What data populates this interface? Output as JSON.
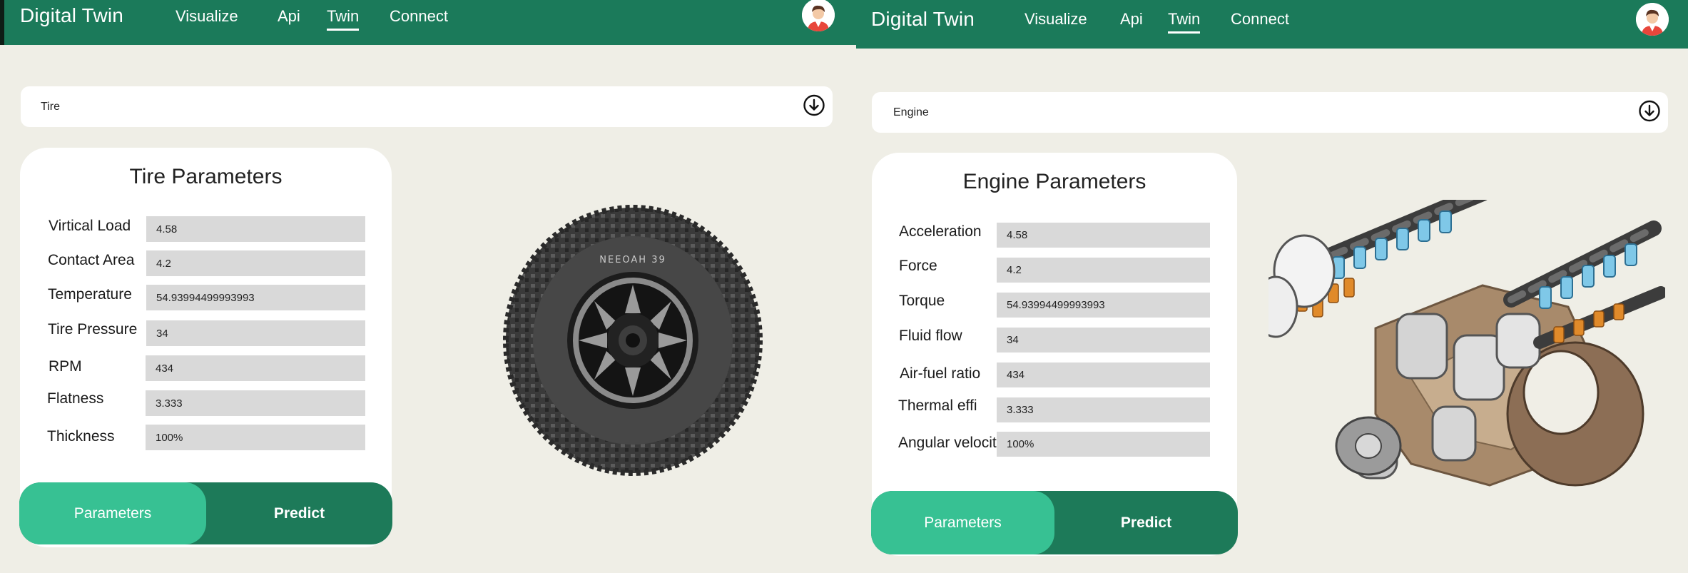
{
  "left": {
    "header": {
      "brand": "Digital Twin",
      "nav": [
        "Visualize",
        "Api",
        "Twin",
        "Connect"
      ],
      "active_nav": "Twin"
    },
    "selector": {
      "value": "Tire"
    },
    "card": {
      "title": "Tire Parameters",
      "params": [
        {
          "label": "Virtical Load",
          "value": "4.58"
        },
        {
          "label": "Contact Area",
          "value": "4.2"
        },
        {
          "label": "Temperature",
          "value": "54.93994499993993"
        },
        {
          "label": "Tire Pressure",
          "value": "34"
        },
        {
          "label": "RPM",
          "value": "434"
        },
        {
          "label": "Flatness",
          "value": "3.333"
        },
        {
          "label": "Thickness",
          "value": "100%"
        }
      ]
    },
    "toggle": {
      "parameters": "Parameters",
      "predict": "Predict"
    },
    "visual": {
      "tire_sidewall_text": "NEEOAH 39"
    }
  },
  "right": {
    "header": {
      "brand": "Digital Twin",
      "nav": [
        "Visualize",
        "Api",
        "Twin",
        "Connect"
      ],
      "active_nav": "Twin"
    },
    "selector": {
      "value": "Engine"
    },
    "card": {
      "title": "Engine Parameters",
      "params": [
        {
          "label": "Acceleration",
          "value": "4.58"
        },
        {
          "label": "Force",
          "value": "4.2"
        },
        {
          "label": "Torque",
          "value": "54.93994499993993"
        },
        {
          "label": "Fluid flow",
          "value": "34"
        },
        {
          "label": "Air-fuel ratio",
          "value": "434"
        },
        {
          "label": "Thermal effi",
          "value": "3.333"
        },
        {
          "label": "Angular velocity",
          "value": "100%"
        }
      ]
    },
    "toggle": {
      "parameters": "Parameters",
      "predict": "Predict"
    }
  },
  "colors": {
    "header_green": "#1b7a5a",
    "toggle_dark": "#1d7a59",
    "toggle_active": "#37c193",
    "background": "#efeee6",
    "input_gray": "#d9d9d9"
  },
  "icons": [
    "user-avatar-icon",
    "chevron-down-circle-icon"
  ]
}
